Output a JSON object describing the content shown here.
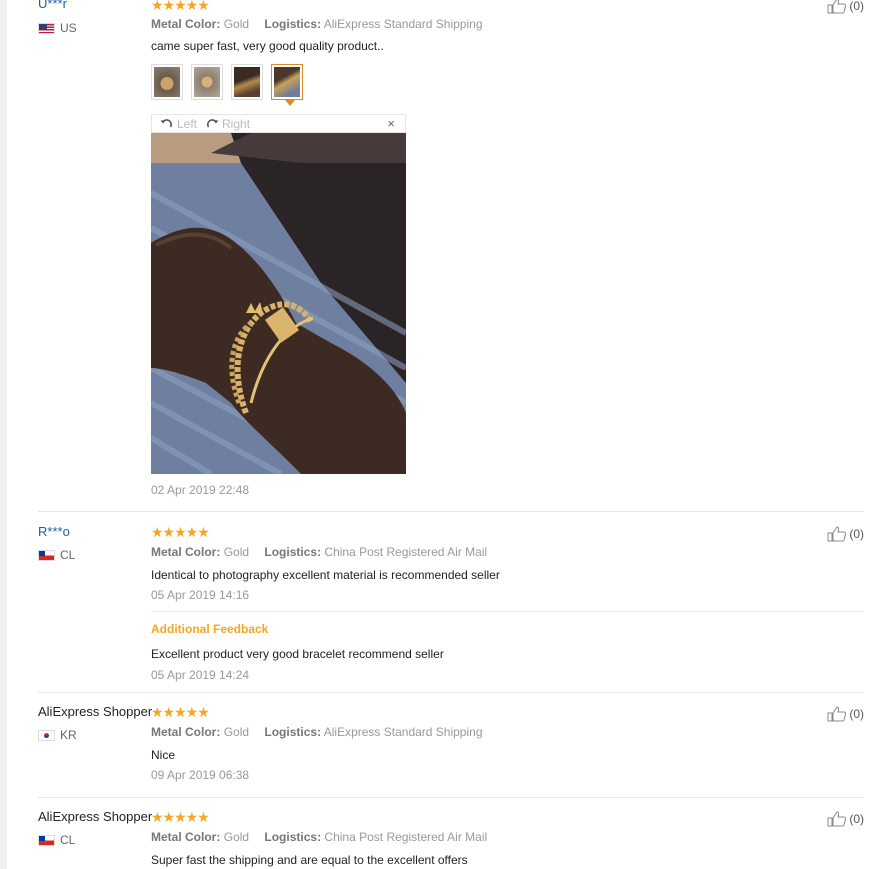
{
  "labels": {
    "color_key": "Metal Color:",
    "logistics_key": "Logistics:",
    "additional_feedback": "Additional Feedback"
  },
  "viewer": {
    "left_label": "Left",
    "right_label": "Right",
    "close_glyph": "×"
  },
  "reviews": [
    {
      "user": "U***r",
      "country": "US",
      "stars": "★★★★★",
      "color": "Gold",
      "logistics": "AliExpress Standard Shipping",
      "text": "came super fast, very good quality product..",
      "date": "02 Apr 2019 22:48",
      "likes": "(0)"
    },
    {
      "user": "R***o",
      "country": "CL",
      "stars": "★★★★★",
      "color": "Gold",
      "logistics": "China Post Registered Air Mail",
      "text": "Identical to photography excellent material is recommended seller",
      "date": "05 Apr 2019 14:16",
      "additional_text": "Excellent product very good bracelet recommend seller",
      "additional_date": "05 Apr 2019 14:24",
      "likes": "(0)"
    },
    {
      "user": "AliExpress Shopper",
      "country": "KR",
      "stars": "★★★★★",
      "color": "Gold",
      "logistics": "AliExpress Standard Shipping",
      "text": "Nice",
      "date": "09 Apr 2019 06:38",
      "likes": "(0)"
    },
    {
      "user": "AliExpress Shopper",
      "country": "CL",
      "stars": "★★★★★",
      "color": "Gold",
      "logistics": "China Post Registered Air Mail",
      "text": "Super fast the shipping and are equal to the excellent offers",
      "likes": "(0)"
    }
  ],
  "colors": {
    "link": "#1861a8",
    "star": "#f5a623",
    "accent": "#e0892b"
  }
}
